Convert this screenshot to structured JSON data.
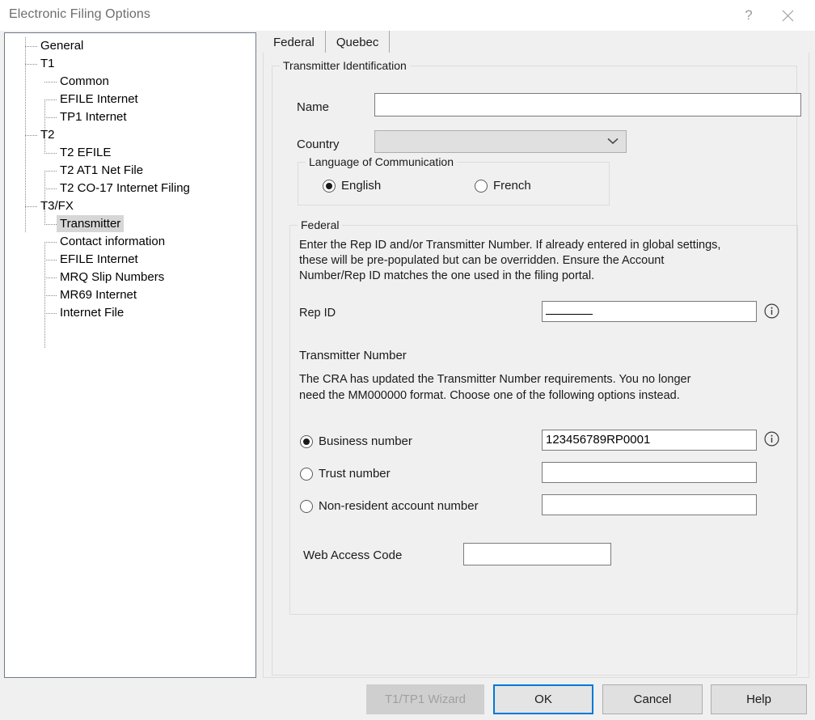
{
  "window": {
    "title": "Electronic Filing Options",
    "help_glyph": "?",
    "help_name": "help-titlebar-button",
    "close_name": "close-button"
  },
  "tree": {
    "selected": "Transmitter",
    "nodes": [
      {
        "label": "General",
        "level": 1
      },
      {
        "label": "T1",
        "level": 1
      },
      {
        "label": "Common",
        "level": 2
      },
      {
        "label": "EFILE Internet",
        "level": 2
      },
      {
        "label": "TP1 Internet",
        "level": 2
      },
      {
        "label": "T2",
        "level": 1
      },
      {
        "label": "T2 EFILE",
        "level": 2
      },
      {
        "label": "T2 AT1 Net File",
        "level": 2
      },
      {
        "label": "T2 CO-17 Internet Filing",
        "level": 2
      },
      {
        "label": "T3/FX",
        "level": 1
      },
      {
        "label": "Transmitter",
        "level": 2
      },
      {
        "label": "Contact information",
        "level": 2
      },
      {
        "label": "EFILE Internet",
        "level": 2
      },
      {
        "label": "MRQ Slip Numbers",
        "level": 2
      },
      {
        "label": "MR69 Internet",
        "level": 2
      },
      {
        "label": "Internet File",
        "level": 2
      }
    ]
  },
  "tabs": [
    {
      "label": "Federal",
      "active": true
    },
    {
      "label": "Quebec",
      "active": false
    }
  ],
  "transmitter": {
    "group_title": "Transmitter Identification",
    "name_label": "Name",
    "name_value": "",
    "country_label": "Country",
    "country_value": "",
    "language": {
      "group_title": "Language of Communication",
      "options": [
        {
          "label": "English",
          "selected": true
        },
        {
          "label": "French",
          "selected": false
        }
      ]
    },
    "federal": {
      "group_title": "Federal",
      "intro_line1": "Enter the Rep ID and/or Transmitter Number. If already entered in global settings,",
      "intro_line2": "these will be pre-populated but can be overridden.  Ensure the Account",
      "intro_line3": "Number/Rep ID matches the one used in the filing portal.",
      "rep_id_label": "Rep ID",
      "rep_id_value": "",
      "transmitter_number_label": "Transmitter Number",
      "tn_line1": "The CRA has updated the Transmitter Number requirements. You no longer",
      "tn_line2": "need the MM000000 format. Choose one of the following options instead.",
      "options": [
        {
          "label": "Business number",
          "selected": true,
          "value": "123456789RP0001"
        },
        {
          "label": "Trust number",
          "selected": false,
          "value": ""
        },
        {
          "label": "Non-resident account number",
          "selected": false,
          "value": ""
        }
      ],
      "web_access_code_label": "Web Access Code",
      "web_access_code_value": ""
    }
  },
  "buttons": [
    {
      "label": "T1/TP1 Wizard",
      "state": "disabled"
    },
    {
      "label": "OK",
      "state": "default"
    },
    {
      "label": "Cancel",
      "state": "normal"
    },
    {
      "label": "Help",
      "state": "normal"
    }
  ],
  "colors": {
    "accent": "#0078d7",
    "window_bg": "#f0f0f0",
    "field_bg": "#ffffff",
    "selection": "#d6d6d6"
  }
}
